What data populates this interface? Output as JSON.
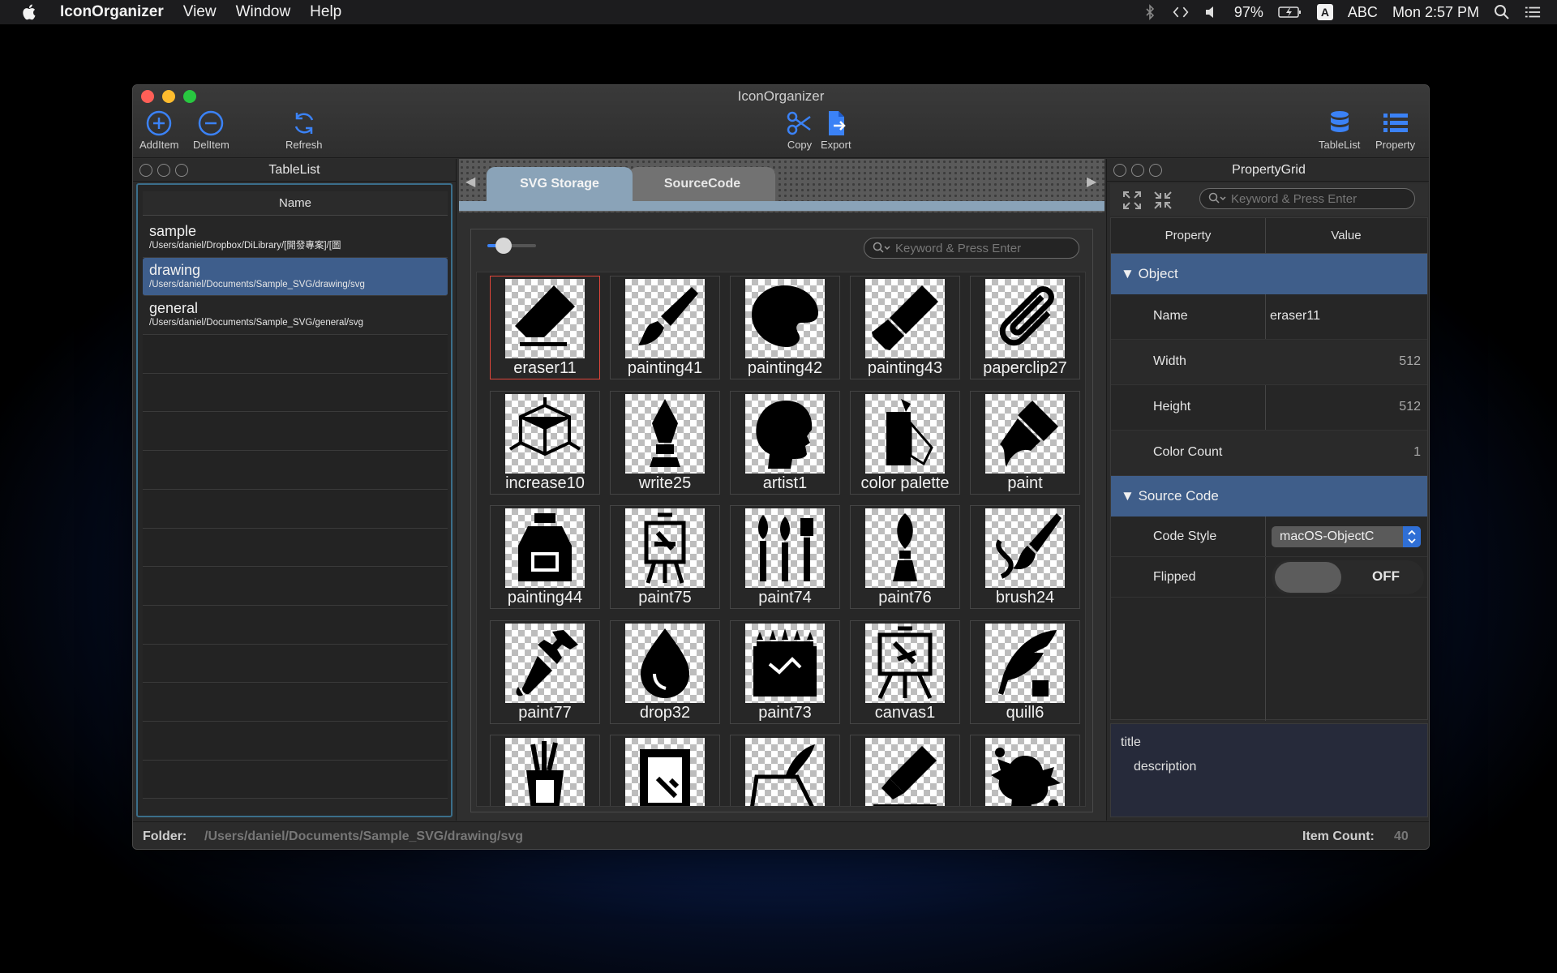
{
  "menubar": {
    "app_name": "IconOrganizer",
    "items": [
      "View",
      "Window",
      "Help"
    ],
    "battery": "97%",
    "input_source": "ABC",
    "input_badge": "A",
    "clock": "Mon 2:57 PM"
  },
  "window": {
    "title": "IconOrganizer",
    "toolbar": {
      "add": "AddItem",
      "del": "DelItem",
      "refresh": "Refresh",
      "copy": "Copy",
      "export": "Export",
      "tablelist": "TableList",
      "property": "Property"
    },
    "accent": "#3b82f6"
  },
  "tablelist": {
    "title": "TableList",
    "column": "Name",
    "rows": [
      {
        "name": "sample",
        "path": "/Users/daniel/Dropbox/DiLibrary/[開發專案]/[圖"
      },
      {
        "name": "drawing",
        "path": "/Users/daniel/Documents/Sample_SVG/drawing/svg"
      },
      {
        "name": "general",
        "path": "/Users/daniel/Documents/Sample_SVG/general/svg"
      }
    ]
  },
  "center": {
    "tabs": [
      "SVG Storage",
      "SourceCode"
    ],
    "search_placeholder": "Keyword & Press Enter",
    "icons": [
      {
        "label": "eraser11",
        "icon": "eraser-icon"
      },
      {
        "label": "painting41",
        "icon": "paint-brush-icon"
      },
      {
        "label": "painting42",
        "icon": "palette-icon"
      },
      {
        "label": "painting43",
        "icon": "paint-tube-icon"
      },
      {
        "label": "paperclip27",
        "icon": "paperclip-icon"
      },
      {
        "label": "increase10",
        "icon": "cube-icon"
      },
      {
        "label": "write25",
        "icon": "fountain-pen-icon"
      },
      {
        "label": "artist1",
        "icon": "head-silhouette-icon"
      },
      {
        "label": "color palette",
        "icon": "swatch-icon"
      },
      {
        "label": "paint",
        "icon": "brush-icon"
      },
      {
        "label": "painting44",
        "icon": "paint-bottle-icon"
      },
      {
        "label": "paint75",
        "icon": "easel-icon"
      },
      {
        "label": "paint74",
        "icon": "brushes-icon"
      },
      {
        "label": "paint76",
        "icon": "round-brush-icon"
      },
      {
        "label": "brush24",
        "icon": "brush-stroke-icon"
      },
      {
        "label": "paint77",
        "icon": "dropper-icon"
      },
      {
        "label": "drop32",
        "icon": "drop-icon"
      },
      {
        "label": "paint73",
        "icon": "crayons-icon"
      },
      {
        "label": "canvas1",
        "icon": "canvas-icon"
      },
      {
        "label": "quill6",
        "icon": "quill-icon"
      },
      {
        "label": "",
        "icon": "brush-cup-icon"
      },
      {
        "label": "",
        "icon": "paint-can-icon"
      },
      {
        "label": "",
        "icon": "pen-paper-icon"
      },
      {
        "label": "",
        "icon": "marker-icon"
      },
      {
        "label": "",
        "icon": "splat-icon"
      }
    ]
  },
  "propertygrid": {
    "title": "PropertyGrid",
    "search_placeholder": "Keyword & Press Enter",
    "col_property": "Property",
    "col_value": "Value",
    "cat_object": "Object",
    "name_key": "Name",
    "name_val": "eraser11",
    "width_key": "Width",
    "width_val": "512",
    "height_key": "Height",
    "height_val": "512",
    "colorcount_key": "Color Count",
    "colorcount_val": "1",
    "cat_source": "Source Code",
    "codestyle_key": "Code Style",
    "codestyle_val": "macOS-ObjectC",
    "flipped_key": "Flipped",
    "flipped_val": "OFF",
    "desc_title": "title",
    "desc_text": "description"
  },
  "status": {
    "folder_label": "Folder:",
    "folder_path": "/Users/daniel/Documents/Sample_SVG/drawing/svg",
    "count_label": "Item Count:",
    "count_val": "40"
  }
}
